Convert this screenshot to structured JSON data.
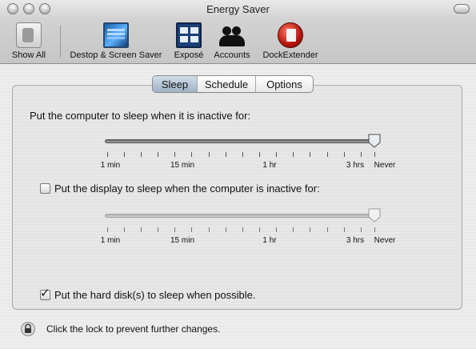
{
  "window": {
    "title": "Energy Saver"
  },
  "toolbar": {
    "items": [
      {
        "label": "Show All",
        "icon": "show-all-icon"
      },
      {
        "label": "Destop & Screen Saver",
        "icon": "desktop-screensaver-icon"
      },
      {
        "label": "Exposé",
        "icon": "expose-icon"
      },
      {
        "label": "Accounts",
        "icon": "accounts-icon"
      },
      {
        "label": "DockExtender",
        "icon": "dockextender-icon"
      }
    ]
  },
  "tabs": [
    {
      "label": "Sleep",
      "selected": true
    },
    {
      "label": "Schedule",
      "selected": false
    },
    {
      "label": "Options",
      "selected": false
    }
  ],
  "computer_sleep": {
    "label": "Put the computer to sleep when it is inactive for:",
    "value": "Never",
    "tick_labels": [
      "1 min",
      "15 min",
      "1 hr",
      "3 hrs",
      "Never"
    ]
  },
  "display_sleep": {
    "label": "Put the display to sleep when the computer is inactive for:",
    "checked": false,
    "enabled": false,
    "value": "Never",
    "tick_labels": [
      "1 min",
      "15 min",
      "1 hr",
      "3 hrs",
      "Never"
    ]
  },
  "disk_sleep": {
    "label": "Put the hard disk(s) to sleep when possible.",
    "checked": true
  },
  "lock": {
    "text": "Click the lock to prevent further changes.",
    "icon": "lock-icon"
  }
}
